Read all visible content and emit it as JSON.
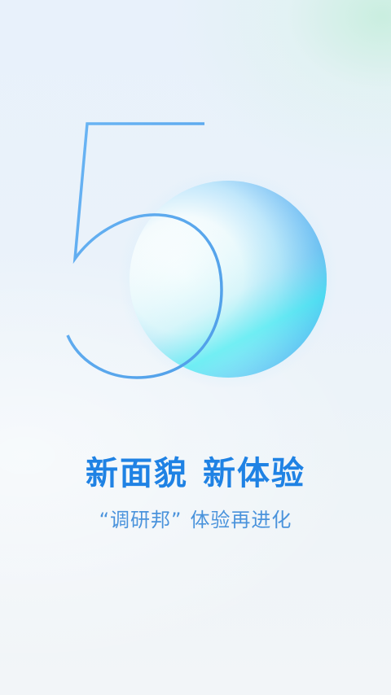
{
  "splash": {
    "version_numeral": "5",
    "headline": {
      "part1": "新面貌",
      "part2": "新体验"
    },
    "tagline": {
      "brand_quoted": "“调研邦”",
      "rest": "体验再进化"
    }
  },
  "colors": {
    "accent": "#1f82e4",
    "tagline": "#4a93dc",
    "numeral_stroke": "#62b2f2",
    "orb_blue": "#4fa6ef",
    "orb_cyan": "#44e8ee"
  }
}
